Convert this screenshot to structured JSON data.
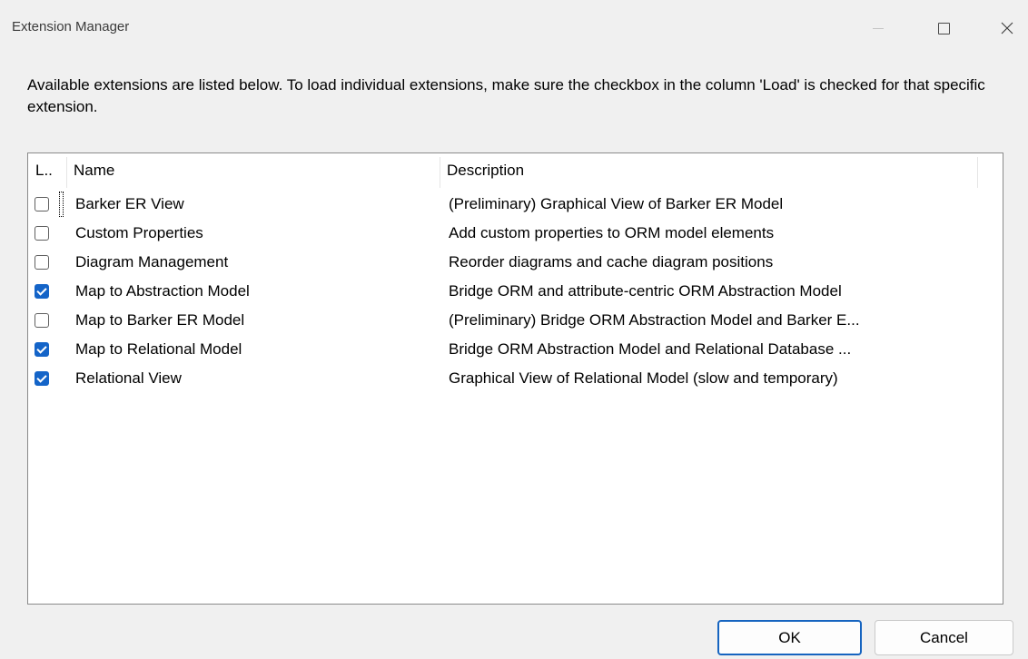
{
  "window": {
    "title": "Extension Manager",
    "minimize_icon": "minimize-icon",
    "maximize_icon": "maximize-icon",
    "close_icon": "close-icon"
  },
  "instructions": "Available extensions are listed below.  To load individual extensions, make sure the checkbox in the column 'Load' is checked for that specific extension.",
  "list": {
    "columns": {
      "load": "L..",
      "name": "Name",
      "description": "Description"
    },
    "rows": [
      {
        "checked": false,
        "name": "Barker ER View",
        "description": "(Preliminary) Graphical View of Barker ER Model"
      },
      {
        "checked": false,
        "name": "Custom Properties",
        "description": "Add custom properties to ORM model elements"
      },
      {
        "checked": false,
        "name": "Diagram Management",
        "description": "Reorder diagrams and cache diagram positions"
      },
      {
        "checked": true,
        "name": "Map to Abstraction Model",
        "description": "Bridge ORM and attribute-centric ORM Abstraction Model"
      },
      {
        "checked": false,
        "name": "Map to Barker ER Model",
        "description": "(Preliminary) Bridge ORM Abstraction Model and Barker E..."
      },
      {
        "checked": true,
        "name": "Map to Relational Model",
        "description": "Bridge ORM Abstraction Model and Relational Database ..."
      },
      {
        "checked": true,
        "name": "Relational View",
        "description": "Graphical View of Relational Model (slow and temporary)"
      }
    ]
  },
  "buttons": {
    "ok": "OK",
    "cancel": "Cancel"
  },
  "colors": {
    "accent": "#1464c8",
    "background": "#f0f0f0"
  }
}
